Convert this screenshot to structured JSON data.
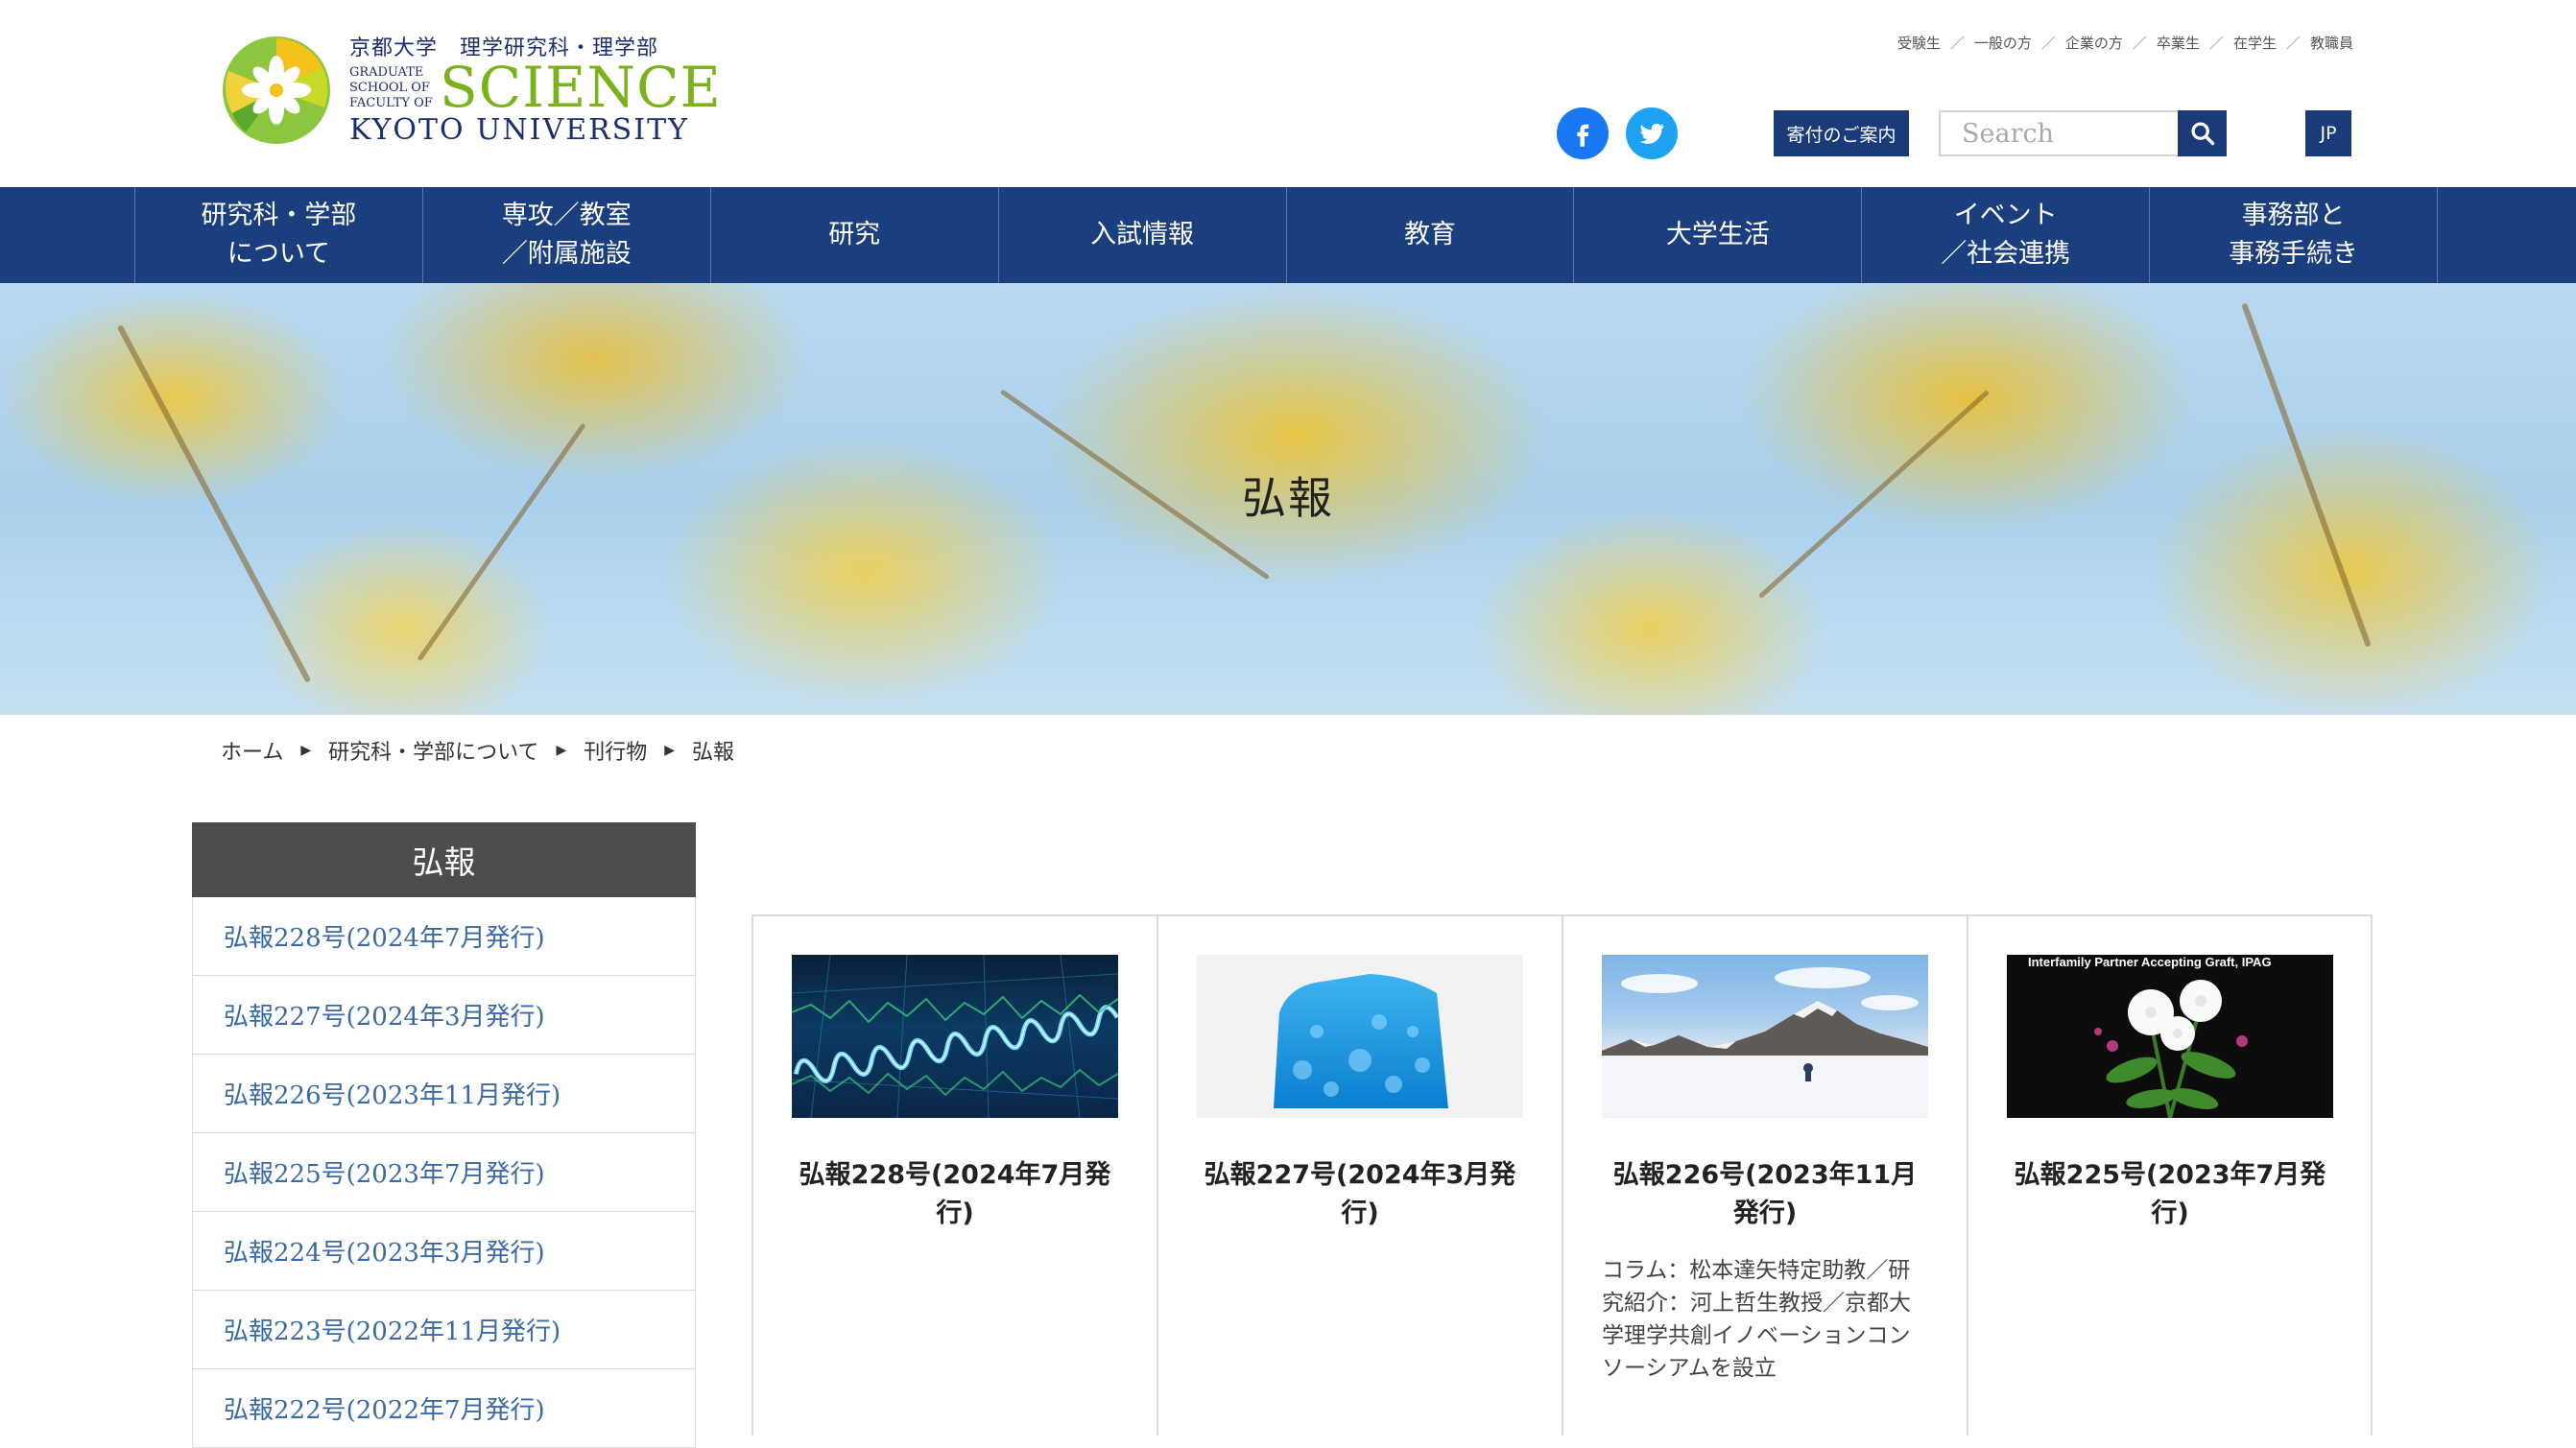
{
  "header": {
    "logo": {
      "univ_jp": "京都大学　理学研究科・理学部",
      "grad_lines": [
        "GRADUATE",
        "SCHOOL OF",
        "FACULTY OF"
      ],
      "science": "SCIENCE",
      "kyoto": "KYOTO UNIVERSITY"
    },
    "top_links": [
      "受験生",
      "一般の方",
      "企業の方",
      "卒業生",
      "在学生",
      "教職員"
    ],
    "top_link_separator": "／",
    "donate_label": "寄付のご案内",
    "search_placeholder": "Search",
    "lang_label": "JP",
    "social": [
      "facebook-icon",
      "twitter-icon"
    ]
  },
  "nav": {
    "items": [
      "研究科・学部\nについて",
      "専攻／教室\n／附属施設",
      "研究",
      "入試情報",
      "教育",
      "大学生活",
      "イベント\n／社会連携",
      "事務部と\n事務手続き"
    ]
  },
  "hero": {
    "title": "弘報"
  },
  "breadcrumb": [
    "ホーム",
    "研究科・学部について",
    "刊行物",
    "弘報"
  ],
  "breadcrumb_separator": "▶",
  "sidebar": {
    "heading": "弘報",
    "items": [
      "弘報228号(2024年7月発行)",
      "弘報227号(2024年3月発行)",
      "弘報226号(2023年11月発行)",
      "弘報225号(2023年7月発行)",
      "弘報224号(2023年3月発行)",
      "弘報223号(2022年11月発行)",
      "弘報222号(2022年7月発行)"
    ]
  },
  "cards": [
    {
      "title": "弘報228号(2024年7月発行)",
      "desc": ""
    },
    {
      "title": "弘報227号(2024年3月発行)",
      "desc": ""
    },
    {
      "title": "弘報226号(2023年11月発行)",
      "desc": "コラム：松本達矢特定助教／研究紹介：河上哲生教授／京都大学理学共創イノベーションコンソーシアムを設立"
    },
    {
      "title": "弘報225号(2023年7月発行)",
      "desc": "",
      "image_caption": "Interfamily Partner Accepting Graft, IPAG"
    }
  ],
  "colors": {
    "nav_bg": "#1a3e7e",
    "logo_green": "#7bb21c",
    "logo_navy": "#1a2f6b",
    "sidebar_head_bg": "#4d4d4d",
    "sidebar_link": "#3a6aa5"
  }
}
